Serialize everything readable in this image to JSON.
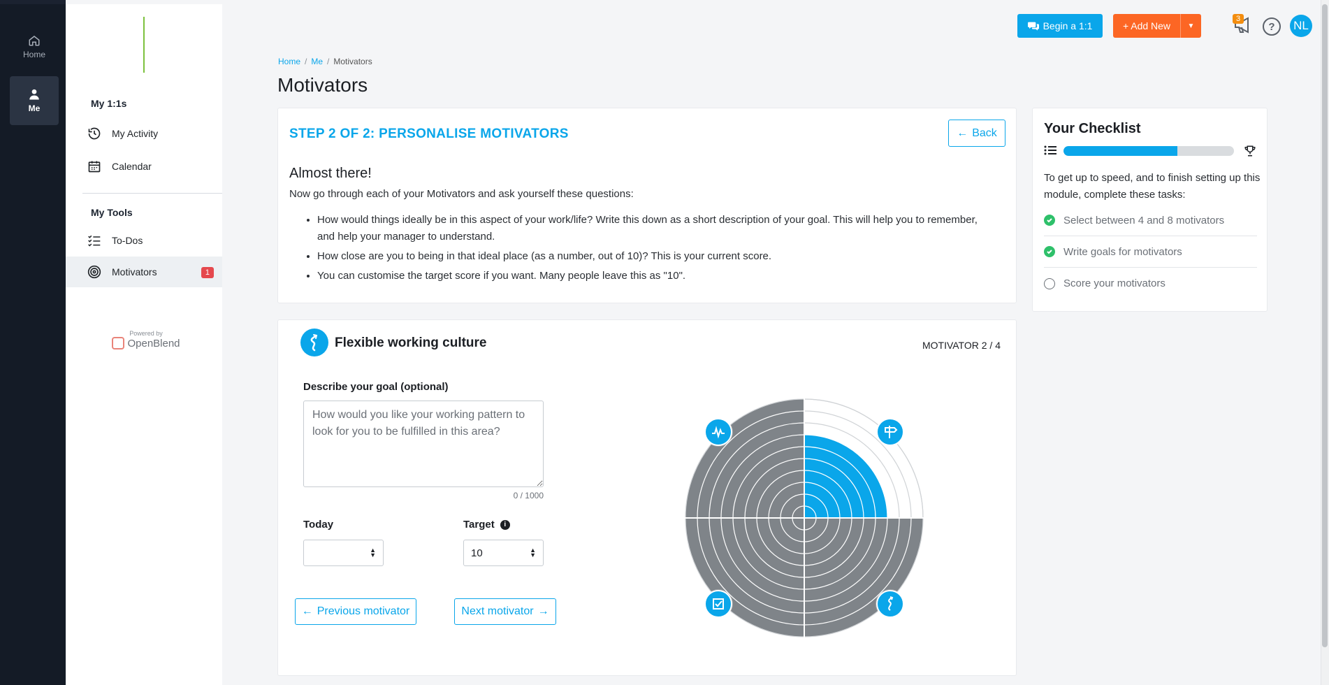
{
  "rail": {
    "home_label": "Home",
    "me_label": "Me"
  },
  "sidebar": {
    "section_1_title": "My 1:1s",
    "items_1": [
      {
        "label": "My Activity",
        "icon": "history-icon"
      },
      {
        "label": "Calendar",
        "icon": "calendar-icon"
      }
    ],
    "section_2_title": "My Tools",
    "items_2": [
      {
        "label": "To-Dos",
        "icon": "todo-list-icon"
      },
      {
        "label": "Motivators",
        "icon": "target-icon",
        "badge": "1"
      }
    ],
    "powered_by": "Powered by",
    "brand": "OpenBlend"
  },
  "topbar": {
    "begin_label": "Begin a 1:1",
    "add_label": "+ Add New",
    "notification_count": "3",
    "help_label": "?",
    "avatar_initials": "NL",
    "accent": "#0aa6ea",
    "add_color": "#fc6624"
  },
  "breadcrumb": {
    "home": "Home",
    "me": "Me",
    "current": "Motivators"
  },
  "page_title": "Motivators",
  "step": {
    "title": "STEP 2 OF 2: PERSONALISE MOTIVATORS",
    "back_label": "Back",
    "heading": "Almost there!",
    "intro": "Now go through each of your Motivators and ask yourself these questions:",
    "questions": [
      "How would things ideally be in this aspect of your work/life? Write this down as a short description of your goal. This will help you to remember, and help your manager to understand.",
      "How close are you to being in that ideal place (as a number, out of 10)? This is your current score.",
      "You can customise the target score if you want. Many people leave this as \"10\"."
    ]
  },
  "checklist": {
    "title": "Your Checklist",
    "progress": 0.67,
    "description": "To get up to speed, and to finish setting up this module, complete these tasks:",
    "tasks": [
      {
        "label": "Select between 4 and 8 motivators",
        "done": true
      },
      {
        "label": "Write goals for motivators",
        "done": true
      },
      {
        "label": "Score your motivators",
        "done": false
      }
    ]
  },
  "motivator": {
    "name": "Flexible working culture",
    "counter": "MOTIVATOR 2 / 4",
    "goal_label": "Describe your goal (optional)",
    "goal_placeholder": "How would you like your working pattern to look for you to be fulfilled in this area?",
    "goal_value": "",
    "char_count": "0 / 1000",
    "today_label": "Today",
    "today_value": "",
    "target_label": "Target",
    "target_value": "10",
    "prev_label": "Previous motivator",
    "next_label": "Next motivator",
    "wheel": {
      "rings": 10,
      "segments": [
        {
          "icon": "pulse-icon",
          "score": 10,
          "color": "#7f8489"
        },
        {
          "icon": "signpost-icon",
          "score": 0,
          "target": 10,
          "active_score": 7,
          "color": "#0aa6ea"
        },
        {
          "icon": "winding-path-icon",
          "score": 10,
          "color": "#7f8489"
        },
        {
          "icon": "checkbox-icon",
          "score": 10,
          "color": "#7f8489"
        }
      ]
    }
  }
}
